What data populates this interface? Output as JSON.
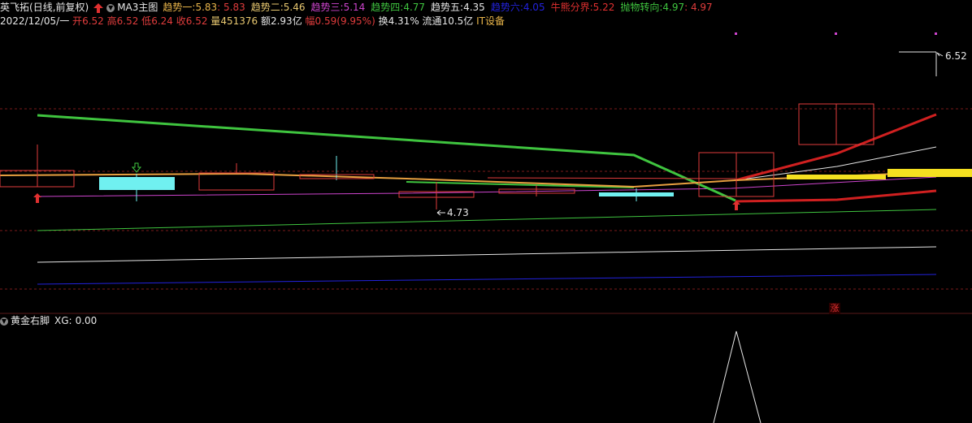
{
  "header": {
    "stock_name": "英飞拓",
    "period": "(日线,前复权)",
    "indicator": "MA3主图",
    "trends": [
      {
        "label": "趋势一:",
        "value": "5.83",
        "value2": "5.83",
        "color": "#e8b44a",
        "value2_color": "#e03c3c"
      },
      {
        "label": "趋势二:",
        "value": "5.46",
        "color": "#e8c870"
      },
      {
        "label": "趋势三:",
        "value": "5.14",
        "color": "#cc44cc"
      },
      {
        "label": "趋势四:",
        "value": "4.77",
        "color": "#3fc43f"
      },
      {
        "label": "趋势五:",
        "value": "4.35",
        "color": "#e6e6e6"
      },
      {
        "label": "趋势六:",
        "value": "4.05",
        "color": "#2222dd"
      },
      {
        "label": "牛熊分界:",
        "value": "5.22",
        "color": "#e03030"
      },
      {
        "label": "抛物转向:",
        "value": "4.97",
        "value2": "4.97",
        "color": "#3fc43f",
        "value2_color": "#e03c3c"
      }
    ]
  },
  "quote": {
    "date": "2022/12/05/一",
    "open_label": "开",
    "open": "6.52",
    "high_label": "高",
    "high": "6.52",
    "low_label": "低",
    "low": "6.24",
    "close_label": "收",
    "close": "6.52",
    "volume_label": "量",
    "volume": "451376",
    "amount_label": "额",
    "amount": "2.93亿",
    "range_label": "幅",
    "range": "0.59(9.95%)",
    "turnover_label": "换",
    "turnover": "4.31%",
    "float_label": "流通",
    "float": "10.5亿",
    "sector": "IT设备"
  },
  "chart": {
    "high_marker": "6.52",
    "low_marker": "4.73",
    "limit_up_tag": "涨"
  },
  "sub": {
    "name": "黄金右脚",
    "xg_label": "XG:",
    "xg_value": "0.00"
  },
  "colors": {
    "background": "#000000",
    "up": "#e03c3c",
    "down": "#70f0f0",
    "grid": "#7a1a1a"
  }
}
